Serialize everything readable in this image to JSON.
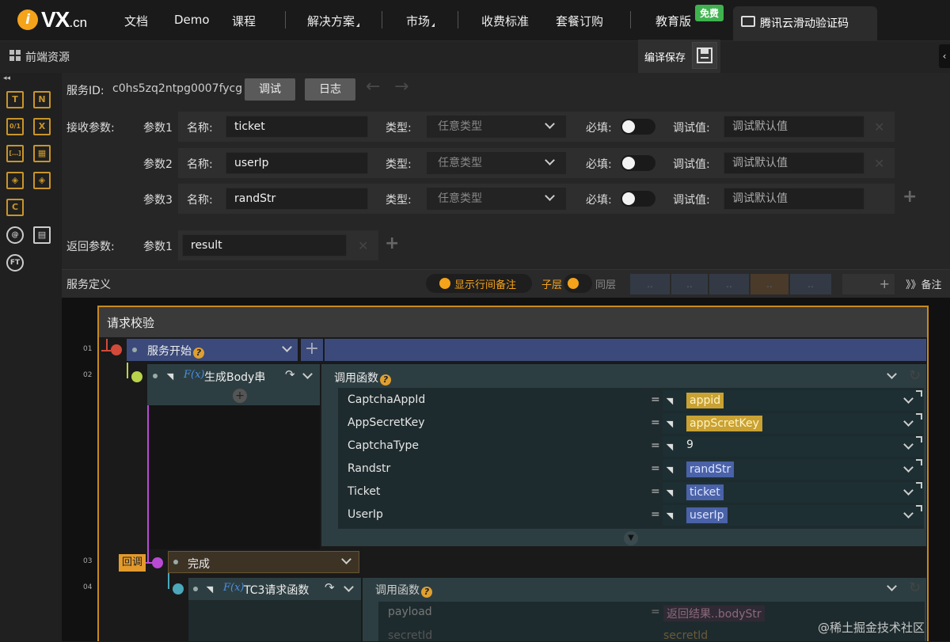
{
  "nav": {
    "logo_letter": "i",
    "logo_main": "VX",
    "logo_suffix": ".cn",
    "items": [
      "文档",
      "Demo",
      "课程",
      "解决方案",
      "市场",
      "收费标准",
      "套餐订购",
      "教育版"
    ],
    "free_badge": "免费",
    "active_tab": "腾讯云滑动验证码"
  },
  "toolbar": {
    "section_title": "前端资源",
    "save_label": "编译保存",
    "right_tab": "‹"
  },
  "sidebar": {
    "collapse": "◂◂",
    "icons": [
      "T",
      "N",
      "0/1",
      "X",
      "[…]",
      "▦",
      "◈",
      "◈",
      "C",
      "@",
      "▤",
      "FT"
    ]
  },
  "service": {
    "id_label": "服务ID:",
    "id_value": "c0hs5zq2ntpg0007fycg",
    "debug_btn": "调试",
    "log_btn": "日志",
    "receive_label": "接收参数:",
    "params": [
      {
        "label": "参数1",
        "name_label": "名称:",
        "name": "ticket",
        "type_label": "类型:",
        "type": "任意类型",
        "required_label": "必填:",
        "test_label": "调试值:",
        "test_placeholder": "调试默认值"
      },
      {
        "label": "参数2",
        "name_label": "名称:",
        "name": "userIp",
        "type_label": "类型:",
        "type": "任意类型",
        "required_label": "必填:",
        "test_label": "调试值:",
        "test_placeholder": "调试默认值"
      },
      {
        "label": "参数3",
        "name_label": "名称:",
        "name": "randStr",
        "type_label": "类型:",
        "type": "任意类型",
        "required_label": "必填:",
        "test_label": "调试值:",
        "test_placeholder": "调试默认值"
      }
    ],
    "return_label": "返回参数:",
    "return_param_label": "参数1",
    "return_value": "result"
  },
  "definition": {
    "title": "服务定义",
    "show_notes": "显示行间备注",
    "child_layer": "子层",
    "same_layer": "同层",
    "ghost_buttons": [
      "..",
      "..",
      "..",
      "..",
      ".."
    ],
    "notes": "》》备注"
  },
  "flow": {
    "block_title": "请求校验",
    "line_numbers": [
      "01",
      "02",
      "03",
      "04"
    ],
    "start_node": "服务开始",
    "body_node": "生成Body串",
    "call_function": "调用函数",
    "args": [
      {
        "name": "CaptchaAppId",
        "value": "appid",
        "style": "yellow"
      },
      {
        "name": "AppSecretKey",
        "value": "appScretKey",
        "style": "yellow"
      },
      {
        "name": "CaptchaType",
        "value": "9",
        "style": "plain"
      },
      {
        "name": "Randstr",
        "value": "randStr",
        "style": "blue"
      },
      {
        "name": "Ticket",
        "value": "ticket",
        "style": "blue"
      },
      {
        "name": "UserIp",
        "value": "userIp",
        "style": "blue"
      }
    ],
    "callback_tag": "回调",
    "done_node": "完成",
    "tc3_node": "TC3请求函数",
    "call_function_2": "调用函数",
    "args2": [
      {
        "name": "payload",
        "value": "返回结果..bodyStr"
      },
      {
        "name": "secretId",
        "value": "secretId"
      }
    ]
  },
  "watermark": "@稀土掘金技术社区"
}
